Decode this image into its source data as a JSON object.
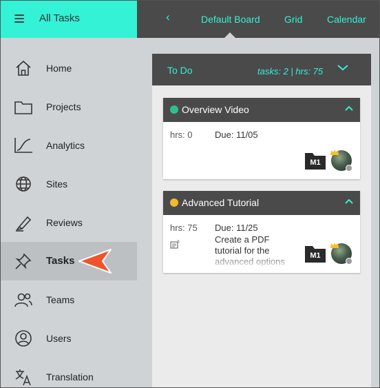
{
  "header": {
    "app_title": "All Tasks",
    "tabs": [
      {
        "label": "Default Board"
      },
      {
        "label": "Grid"
      },
      {
        "label": "Calendar"
      }
    ]
  },
  "sidebar": {
    "items": [
      {
        "label": "Home",
        "icon": "home-icon"
      },
      {
        "label": "Projects",
        "icon": "folder-icon"
      },
      {
        "label": "Analytics",
        "icon": "analytics-icon"
      },
      {
        "label": "Sites",
        "icon": "globe-icon"
      },
      {
        "label": "Reviews",
        "icon": "pen-icon"
      },
      {
        "label": "Tasks",
        "icon": "pin-icon",
        "active": true
      },
      {
        "label": "Teams",
        "icon": "team-icon"
      },
      {
        "label": "Users",
        "icon": "user-icon"
      },
      {
        "label": "Translation",
        "icon": "translate-icon"
      }
    ]
  },
  "board": {
    "title": "To Do",
    "stats": "tasks: 2 | hrs: 75",
    "cards": [
      {
        "title": "Overview Video",
        "status_color": "#2fbf8f",
        "hrs": "hrs: 0",
        "due": "Due: 11/05",
        "description": "",
        "badge": "M1"
      },
      {
        "title": "Advanced Tutorial",
        "status_color": "#f5b82e",
        "hrs": "hrs: 75",
        "due": "Due: 11/25",
        "description": "Create a PDF tutorial for the advanced options",
        "badge": "M1"
      }
    ]
  },
  "colors": {
    "accent": "#33f2d6",
    "dark": "#4a4a4a",
    "pointer": "#f0532a"
  }
}
